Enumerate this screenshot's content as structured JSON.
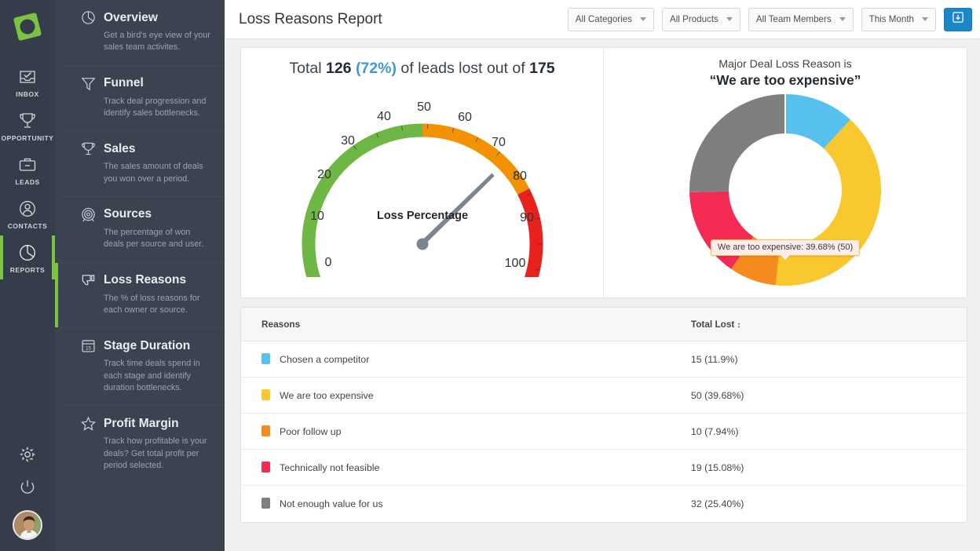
{
  "brand": {
    "logo_color": "#7dc242",
    "accent": "#7dc242"
  },
  "rail": {
    "items": [
      {
        "label": "INBOX",
        "icon": "inbox-icon",
        "active": false
      },
      {
        "label": "OPPORTUNITY",
        "icon": "trophy-icon",
        "active": false
      },
      {
        "label": "LEADS",
        "icon": "briefcase-icon",
        "active": false
      },
      {
        "label": "CONTACTS",
        "icon": "contacts-icon",
        "active": false
      },
      {
        "label": "REPORTS",
        "icon": "pie-chart-icon",
        "active": true
      }
    ],
    "bottom": [
      {
        "label": "Settings",
        "icon": "gear-icon"
      },
      {
        "label": "Logout",
        "icon": "power-icon"
      }
    ]
  },
  "subnav": {
    "items": [
      {
        "title": "Overview",
        "desc": "Get a bird's eye view of your sales team activites.",
        "icon": "pie-chart-icon",
        "active": false
      },
      {
        "title": "Funnel",
        "desc": "Track deal progression and identify sales bottlenecks.",
        "icon": "funnel-icon",
        "active": false
      },
      {
        "title": "Sales",
        "desc": "The sales amount of deals you won over a period.",
        "icon": "trophy-icon",
        "active": false
      },
      {
        "title": "Sources",
        "desc": "The percentage of won deals per source and user.",
        "icon": "target-icon",
        "active": false
      },
      {
        "title": "Loss Reasons",
        "desc": "The % of loss reasons for each owner or source.",
        "icon": "thumbs-down-icon",
        "active": true
      },
      {
        "title": "Stage Duration",
        "desc": "Track time deals spend in each stage and identify duration bottlenecks.",
        "icon": "calendar-icon",
        "active": false
      },
      {
        "title": "Profit Margin",
        "desc": "Track how profitable is your deals? Get total profit per period selected.",
        "icon": "star-icon",
        "active": false
      }
    ]
  },
  "header": {
    "title": "Loss Reasons Report",
    "filters": [
      {
        "name": "categories",
        "value": "All Categories"
      },
      {
        "name": "products",
        "value": "All Products"
      },
      {
        "name": "team_members",
        "value": "All Team Members"
      },
      {
        "name": "period",
        "value": "This Month"
      }
    ],
    "export_icon": "download-icon"
  },
  "summary": {
    "prefix": "Total",
    "lost": "126",
    "percent": "(72%)",
    "middle": "of leads lost out of",
    "total": "175"
  },
  "donut_heading": {
    "line1": "Major Deal Loss Reason is",
    "line2": "“We are too expensive”"
  },
  "tooltip": {
    "text": "We are too expensive: 39.68% (50)"
  },
  "table": {
    "columns": [
      "Reasons",
      "Total Lost"
    ],
    "sort_indicator": "↕",
    "rows": [
      {
        "color": "#56c1ee",
        "reason": "Chosen a competitor",
        "total": "15 (11.9%)"
      },
      {
        "color": "#f8c82e",
        "reason": "We are too expensive",
        "total": "50 (39.68%)"
      },
      {
        "color": "#f58b1f",
        "reason": "Poor follow up",
        "total": "10 (7.94%)"
      },
      {
        "color": "#f32b55",
        "reason": "Technically not feasible",
        "total": "19 (15.08%)"
      },
      {
        "color": "#7f7f7f",
        "reason": "Not enough value for us",
        "total": "32 (25.40%)"
      }
    ]
  },
  "chart_data": [
    {
      "type": "gauge",
      "title": "Loss Percentage",
      "value": 72,
      "min": 0,
      "max": 100,
      "ticks": [
        0,
        10,
        20,
        30,
        40,
        50,
        60,
        70,
        80,
        90,
        100
      ],
      "bands": [
        {
          "from": 0,
          "to": 50,
          "color": "#6eb745"
        },
        {
          "from": 50,
          "to": 75,
          "color": "#f39200"
        },
        {
          "from": 75,
          "to": 100,
          "color": "#e8211c"
        }
      ],
      "needle_color": "#7a8591",
      "start_angle": 215,
      "end_angle": -35
    },
    {
      "type": "pie",
      "subtype": "donut",
      "title": "Major Deal Loss Reason is “We are too expensive”",
      "labels": [
        "Chosen a competitor",
        "We are too expensive",
        "Poor follow up",
        "Technically not feasible",
        "Not enough value for us"
      ],
      "values": [
        15,
        50,
        10,
        19,
        32
      ],
      "percents": [
        11.9,
        39.68,
        7.94,
        15.08,
        25.4
      ],
      "colors": [
        "#56c1ee",
        "#f8c82e",
        "#f58b1f",
        "#f32b55",
        "#7f7f7f"
      ],
      "total": 126,
      "legend": "table",
      "annotation": "We are too expensive: 39.68% (50)"
    }
  ]
}
